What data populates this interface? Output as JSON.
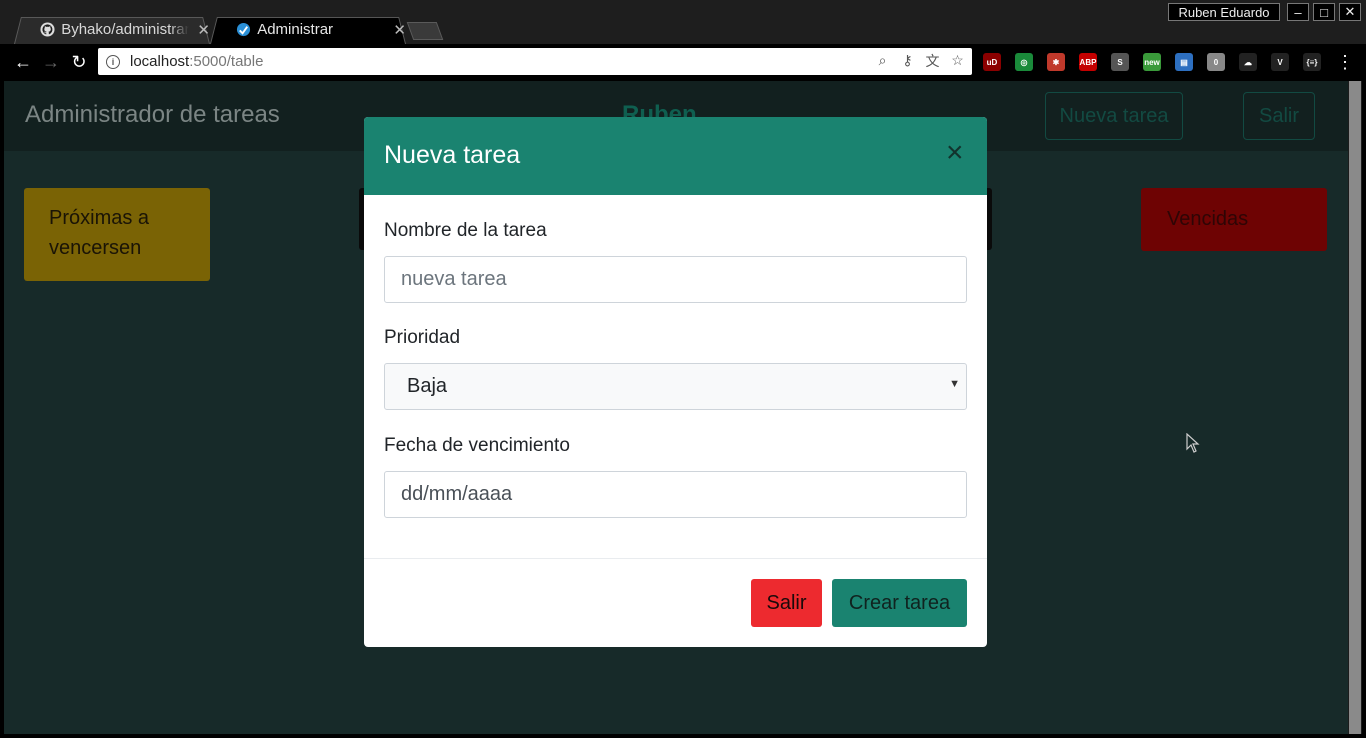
{
  "browser": {
    "tabs": [
      {
        "title": "Byhako/administrar",
        "active": false,
        "favicon": "github-icon"
      },
      {
        "title": "Administrar",
        "active": true,
        "favicon": "app-icon"
      }
    ],
    "profile_name": "Ruben Eduardo",
    "window_buttons": {
      "minimize": "–",
      "maximize": "□",
      "close": "✕"
    },
    "url_host": "localhost",
    "url_path": ":5000/table",
    "extensions": [
      {
        "name": "ublock-icon",
        "glyph": "uD",
        "color": "#8b0000"
      },
      {
        "name": "target-icon",
        "glyph": "◎",
        "color": "#1a8a3a"
      },
      {
        "name": "bug-icon",
        "glyph": "✱",
        "color": "#c0392b"
      },
      {
        "name": "abp-icon",
        "glyph": "ABP",
        "color": "#c40000"
      },
      {
        "name": "s-extension-icon",
        "glyph": "S",
        "color": "#555"
      },
      {
        "name": "android-new-icon",
        "glyph": "new",
        "color": "#3a9a3a"
      },
      {
        "name": "book-icon",
        "glyph": "▤",
        "color": "#2d6fc0"
      },
      {
        "name": "zero-icon",
        "glyph": "0",
        "color": "#888"
      },
      {
        "name": "cloud-icon",
        "glyph": "☁",
        "color": "#222"
      },
      {
        "name": "vue-icon",
        "glyph": "V",
        "color": "#222"
      },
      {
        "name": "json-icon",
        "glyph": "{≡}",
        "color": "#222"
      }
    ]
  },
  "app": {
    "brand": "Administrador de tareas",
    "username": "Ruben",
    "new_task_button": "Nueva tarea",
    "logout_button": "Salir",
    "cards": {
      "upcoming": "Próximas a vencersen",
      "expired": "Vencidas"
    }
  },
  "modal": {
    "title": "Nueva tarea",
    "close": "×",
    "name_label": "Nombre de la tarea",
    "name_placeholder": "nueva tarea",
    "priority_label": "Prioridad",
    "priority_value": "Baja",
    "due_label": "Fecha de vencimiento",
    "due_placeholder": "dd/mm/aaaa",
    "cancel_button": "Salir",
    "submit_button": "Crear tarea"
  },
  "colors": {
    "primary": "#1a8370",
    "danger": "#ed2a2f",
    "backdrop": "#172a29"
  }
}
